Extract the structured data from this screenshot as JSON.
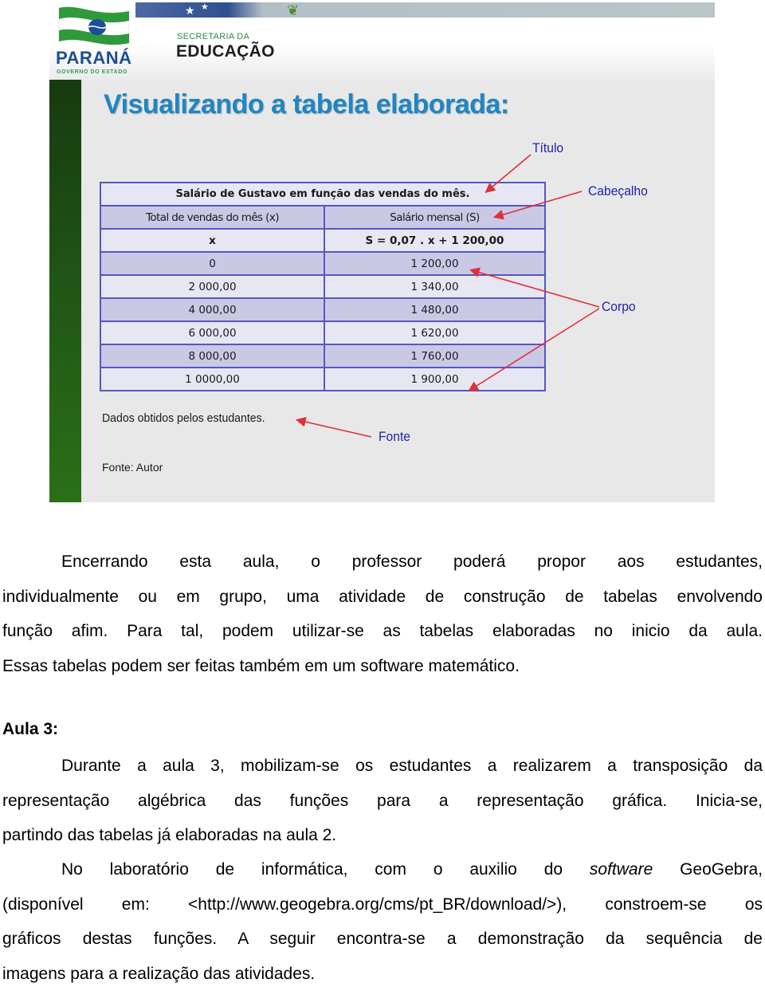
{
  "slide": {
    "banner": {
      "logo_name": "PARANÁ",
      "logo_subtitle": "GOVERNO DO ESTADO",
      "department_line1": "SECRETARIA DA",
      "department_line2": "EDUCAÇÃO"
    },
    "title": "Visualizando a tabela elaborada:",
    "table": {
      "caption": "Salário de Gustavo em função das vendas do mês.",
      "headers": [
        "Total de vendas do mês (x)",
        "Salário mensal (S)"
      ],
      "formula_row": [
        "x",
        "S = 0,07 . x + 1 200,00"
      ],
      "rows": [
        [
          "0",
          "1 200,00"
        ],
        [
          "2 000,00",
          "1 340,00"
        ],
        [
          "4 000,00",
          "1 480,00"
        ],
        [
          "6 000,00",
          "1 620,00"
        ],
        [
          "8 000,00",
          "1 760,00"
        ],
        [
          "1 0000,00",
          "1 900,00"
        ]
      ]
    },
    "source_note": "Dados obtidos pelos estudantes.",
    "annotations": {
      "title": "Título",
      "header": "Cabeçalho",
      "body": "Corpo",
      "source": "Fonte"
    },
    "colors": {
      "title": "#1f86c4",
      "annotation_text": "#1f1fb0",
      "arrow": "#e0303a",
      "table_border": "#5656c4",
      "row_dark": "#c9c9e6",
      "row_light": "#e7e7f3",
      "sidebar_green": "#1f5415"
    },
    "credit": "Fonte: Autor"
  },
  "body": {
    "paragraph1": [
      "Encerrando esta aula, o professor poderá propor aos estudantes,",
      "individualmente ou em grupo, uma atividade de construção de tabelas envolvendo",
      "função afim. Para tal, podem utilizar-se as tabelas elaboradas no inicio da aula.",
      "Essas tabelas podem ser feitas também em um software matemático."
    ],
    "heading": "Aula 3:",
    "paragraph2": [
      "Durante a aula 3, mobilizam-se os estudantes a realizarem a transposição da",
      "representação algébrica das funções para a representação gráfica. Inicia-se,",
      "partindo das tabelas já elaboradas na aula 2."
    ],
    "paragraph3": {
      "line1_before": "No laboratório de informática, com o auxilio do ",
      "line1_italic": "software",
      "line1_after": " GeoGebra,",
      "lines": [
        "(disponível em: <http://www.geogebra.org/cms/pt_BR/download/>), constroem-se os",
        "gráficos destas funções. A seguir encontra-se a demonstração da sequência de",
        "imagens para a realização das atividades."
      ]
    }
  }
}
